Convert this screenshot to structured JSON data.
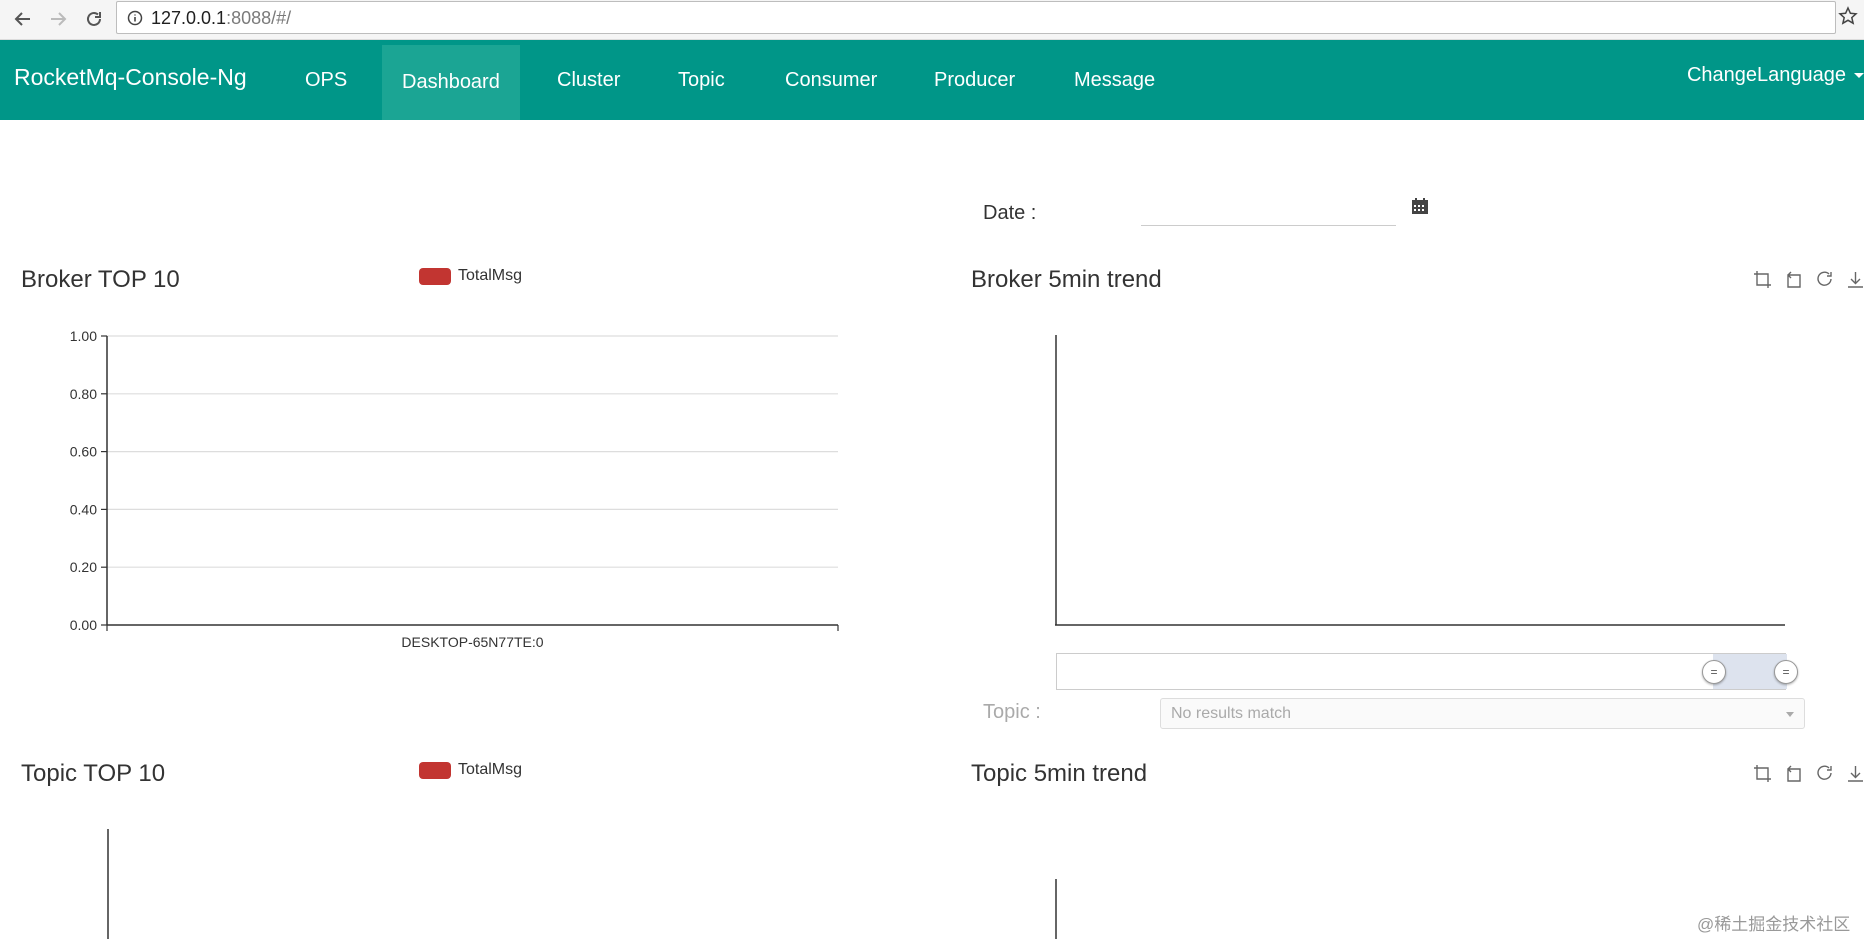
{
  "browser": {
    "url_host": "127.0.0.1",
    "url_rest": ":8088/#/"
  },
  "navbar": {
    "brand": "RocketMq-Console-Ng",
    "items": [
      {
        "label": "OPS",
        "active": false
      },
      {
        "label": "Dashboard",
        "active": true
      },
      {
        "label": "Cluster",
        "active": false
      },
      {
        "label": "Topic",
        "active": false
      },
      {
        "label": "Consumer",
        "active": false
      },
      {
        "label": "Producer",
        "active": false
      },
      {
        "label": "Message",
        "active": false
      }
    ],
    "language": "ChangeLanguage"
  },
  "date": {
    "label": "Date :",
    "value": ""
  },
  "broker_top": {
    "title": "Broker TOP 10",
    "legend": "TotalMsg"
  },
  "broker_trend": {
    "title": "Broker 5min trend"
  },
  "topic_filter": {
    "label": "Topic :",
    "placeholder": "No results match"
  },
  "topic_top": {
    "title": "Topic TOP 10",
    "legend": "TotalMsg"
  },
  "topic_trend": {
    "title": "Topic 5min trend"
  },
  "watermark": "@稀土掘金技术社区",
  "colors": {
    "navbar": "#009688",
    "active_tab": "#1ba594",
    "series": "#c23531"
  },
  "chart_data": [
    {
      "type": "bar",
      "title": "Broker TOP 10",
      "categories": [
        "DESKTOP-65N77TE:0"
      ],
      "series": [
        {
          "name": "TotalMsg",
          "values": [
            0
          ]
        }
      ],
      "ylim": [
        0,
        1
      ],
      "yticks": [
        "0.00",
        "0.20",
        "0.40",
        "0.60",
        "0.80",
        "1.00"
      ],
      "grid": true,
      "legend": "top"
    },
    {
      "type": "line",
      "title": "Broker 5min trend",
      "series": [],
      "data_zoom": {
        "start": 0.9,
        "end": 1.0
      }
    },
    {
      "type": "bar",
      "title": "Topic TOP 10",
      "categories": [],
      "series": [
        {
          "name": "TotalMsg",
          "values": []
        }
      ],
      "legend": "top"
    },
    {
      "type": "line",
      "title": "Topic 5min trend",
      "series": []
    }
  ]
}
